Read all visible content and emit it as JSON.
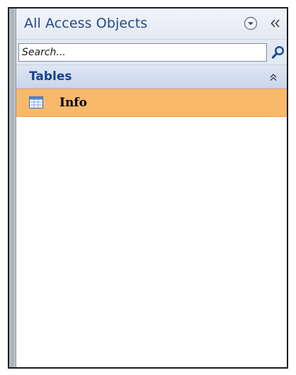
{
  "nav_pane": {
    "title": "All Access Objects",
    "dropdown_icon": "chevron-down-circle-icon",
    "collapse_icon": "double-chevron-left-icon"
  },
  "search": {
    "placeholder": "Search...",
    "value": "",
    "icon": "search-icon"
  },
  "groups": [
    {
      "title": "Tables",
      "toggle_icon": "double-chevron-up-icon",
      "items": [
        {
          "label": "Info",
          "icon": "table-icon",
          "selected": true
        }
      ]
    }
  ],
  "colors": {
    "title_text": "#24498b",
    "group_text": "#15428b",
    "selected_item_bg": "#f8b96b",
    "header_bg": "#e3e9f2",
    "group_bg": "#cad6ea"
  }
}
